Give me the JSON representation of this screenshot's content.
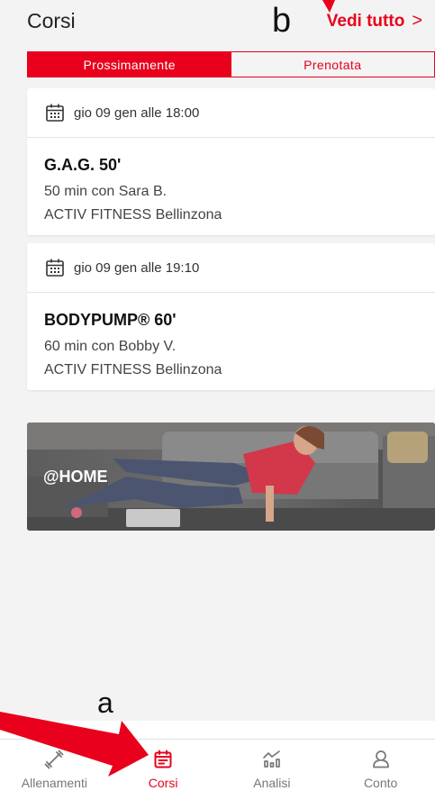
{
  "header": {
    "title": "Corsi",
    "see_all": "Vedi tutto",
    "see_all_chevron": ">"
  },
  "annotations": {
    "a": "a",
    "b": "b"
  },
  "tabs": [
    {
      "label": "Prossimamente",
      "active": true
    },
    {
      "label": "Prenotata",
      "active": false
    }
  ],
  "courses": [
    {
      "date": "gio 09 gen alle 18:00",
      "name": "G.A.G. 50'",
      "detail": "50 min con Sara B.",
      "location": "ACTIV FITNESS Bellinzona"
    },
    {
      "date": "gio 09 gen alle 19:10",
      "name": "BODYPUMP® 60'",
      "detail": "60 min con Bobby V.",
      "location": "ACTIV FITNESS Bellinzona"
    }
  ],
  "banner": {
    "label": "@HOME"
  },
  "bottom_nav": [
    {
      "label": "Allenamenti",
      "icon": "dumbbell-icon",
      "active": false
    },
    {
      "label": "Corsi",
      "icon": "calendar-icon",
      "active": true
    },
    {
      "label": "Analisi",
      "icon": "chart-icon",
      "active": false
    },
    {
      "label": "Conto",
      "icon": "account-icon",
      "active": false
    }
  ],
  "colors": {
    "accent": "#e8001c",
    "background": "#f3f3f3",
    "annotation_arrow": "#e8001c"
  }
}
